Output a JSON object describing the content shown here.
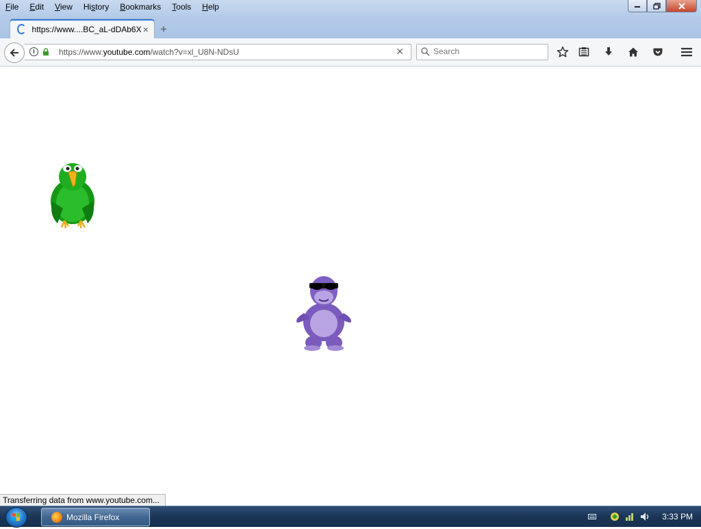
{
  "menubar": {
    "items": [
      {
        "label": "File",
        "accel": "F",
        "rest": "ile"
      },
      {
        "label": "Edit",
        "accel": "E",
        "rest": "dit"
      },
      {
        "label": "View",
        "accel": "V",
        "rest": "iew"
      },
      {
        "label": "History",
        "pre": "Hi",
        "accel": "s",
        "rest": "tory"
      },
      {
        "label": "Bookmarks",
        "accel": "B",
        "rest": "ookmarks"
      },
      {
        "label": "Tools",
        "accel": "T",
        "rest": "ools"
      },
      {
        "label": "Help",
        "accel": "H",
        "rest": "elp"
      }
    ]
  },
  "tab": {
    "title": "https://www....BC_aL-dDAb6X",
    "close": "×"
  },
  "new_tab": "+",
  "urlbar": {
    "url_prefix": "https://www.",
    "url_domain": "youtube.com",
    "url_suffix": "/watch?v=xl_U8N-NDsU"
  },
  "search": {
    "placeholder": "Search",
    "value": ""
  },
  "toolbar_icons": [
    "star-icon",
    "reading-list-icon",
    "download-icon",
    "home-icon",
    "pocket-icon",
    "hamburger-menu-icon"
  ],
  "statusbar": {
    "text": "Transferring data from www.youtube.com..."
  },
  "taskbar": {
    "task_label": "Mozilla Firefox",
    "clock": "3:33 PM"
  },
  "colors": {
    "accent": "#2c7be0",
    "parrot": "#1aa31a",
    "bonzi": "#8a66c9"
  }
}
